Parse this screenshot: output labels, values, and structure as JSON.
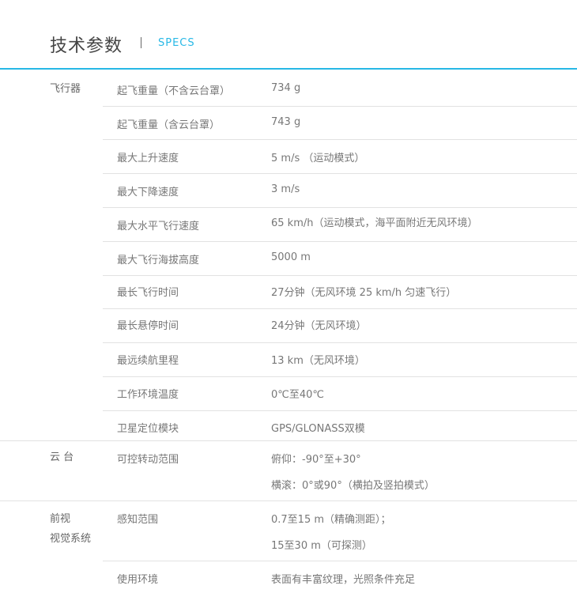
{
  "header": {
    "title": "技术参数",
    "subtitle": "SPECS"
  },
  "sections": [
    {
      "category": "飞行器",
      "rows": [
        {
          "label": "起飞重量（不含云台罩）",
          "value": "734 g"
        },
        {
          "label": "起飞重量（含云台罩）",
          "value": "743 g"
        },
        {
          "label": "最大上升速度",
          "value": "5 m/s （运动模式）"
        },
        {
          "label": "最大下降速度",
          "value": "3 m/s"
        },
        {
          "label": "最大水平飞行速度",
          "value": "65 km/h（运动模式，海平面附近无风环境）"
        },
        {
          "label": "最大飞行海拔高度",
          "value": "5000 m"
        },
        {
          "label": "最长飞行时间",
          "value": "27分钟（无风环境 25 km/h 匀速飞行）"
        },
        {
          "label": "最长悬停时间",
          "value": "24分钟（无风环境）"
        },
        {
          "label": "最远续航里程",
          "value": "13 km（无风环境）"
        },
        {
          "label": "工作环境温度",
          "value": "0℃至40℃"
        },
        {
          "label": "卫星定位模块",
          "value": "GPS/GLONASS双模"
        }
      ]
    },
    {
      "category": "云 台",
      "rows": [
        {
          "label": "可控转动范围",
          "values": [
            "俯仰：-90°至+30°",
            "横滚：0°或90°（横拍及竖拍模式）"
          ]
        }
      ]
    },
    {
      "category_lines": [
        "前视",
        "视觉系统"
      ],
      "rows": [
        {
          "label": "感知范围",
          "values": [
            "0.7至15 m（精确测距）；",
            "15至30 m（可探测）"
          ]
        },
        {
          "label": "使用环境",
          "value": "表面有丰富纹理，光照条件充足"
        }
      ]
    }
  ]
}
